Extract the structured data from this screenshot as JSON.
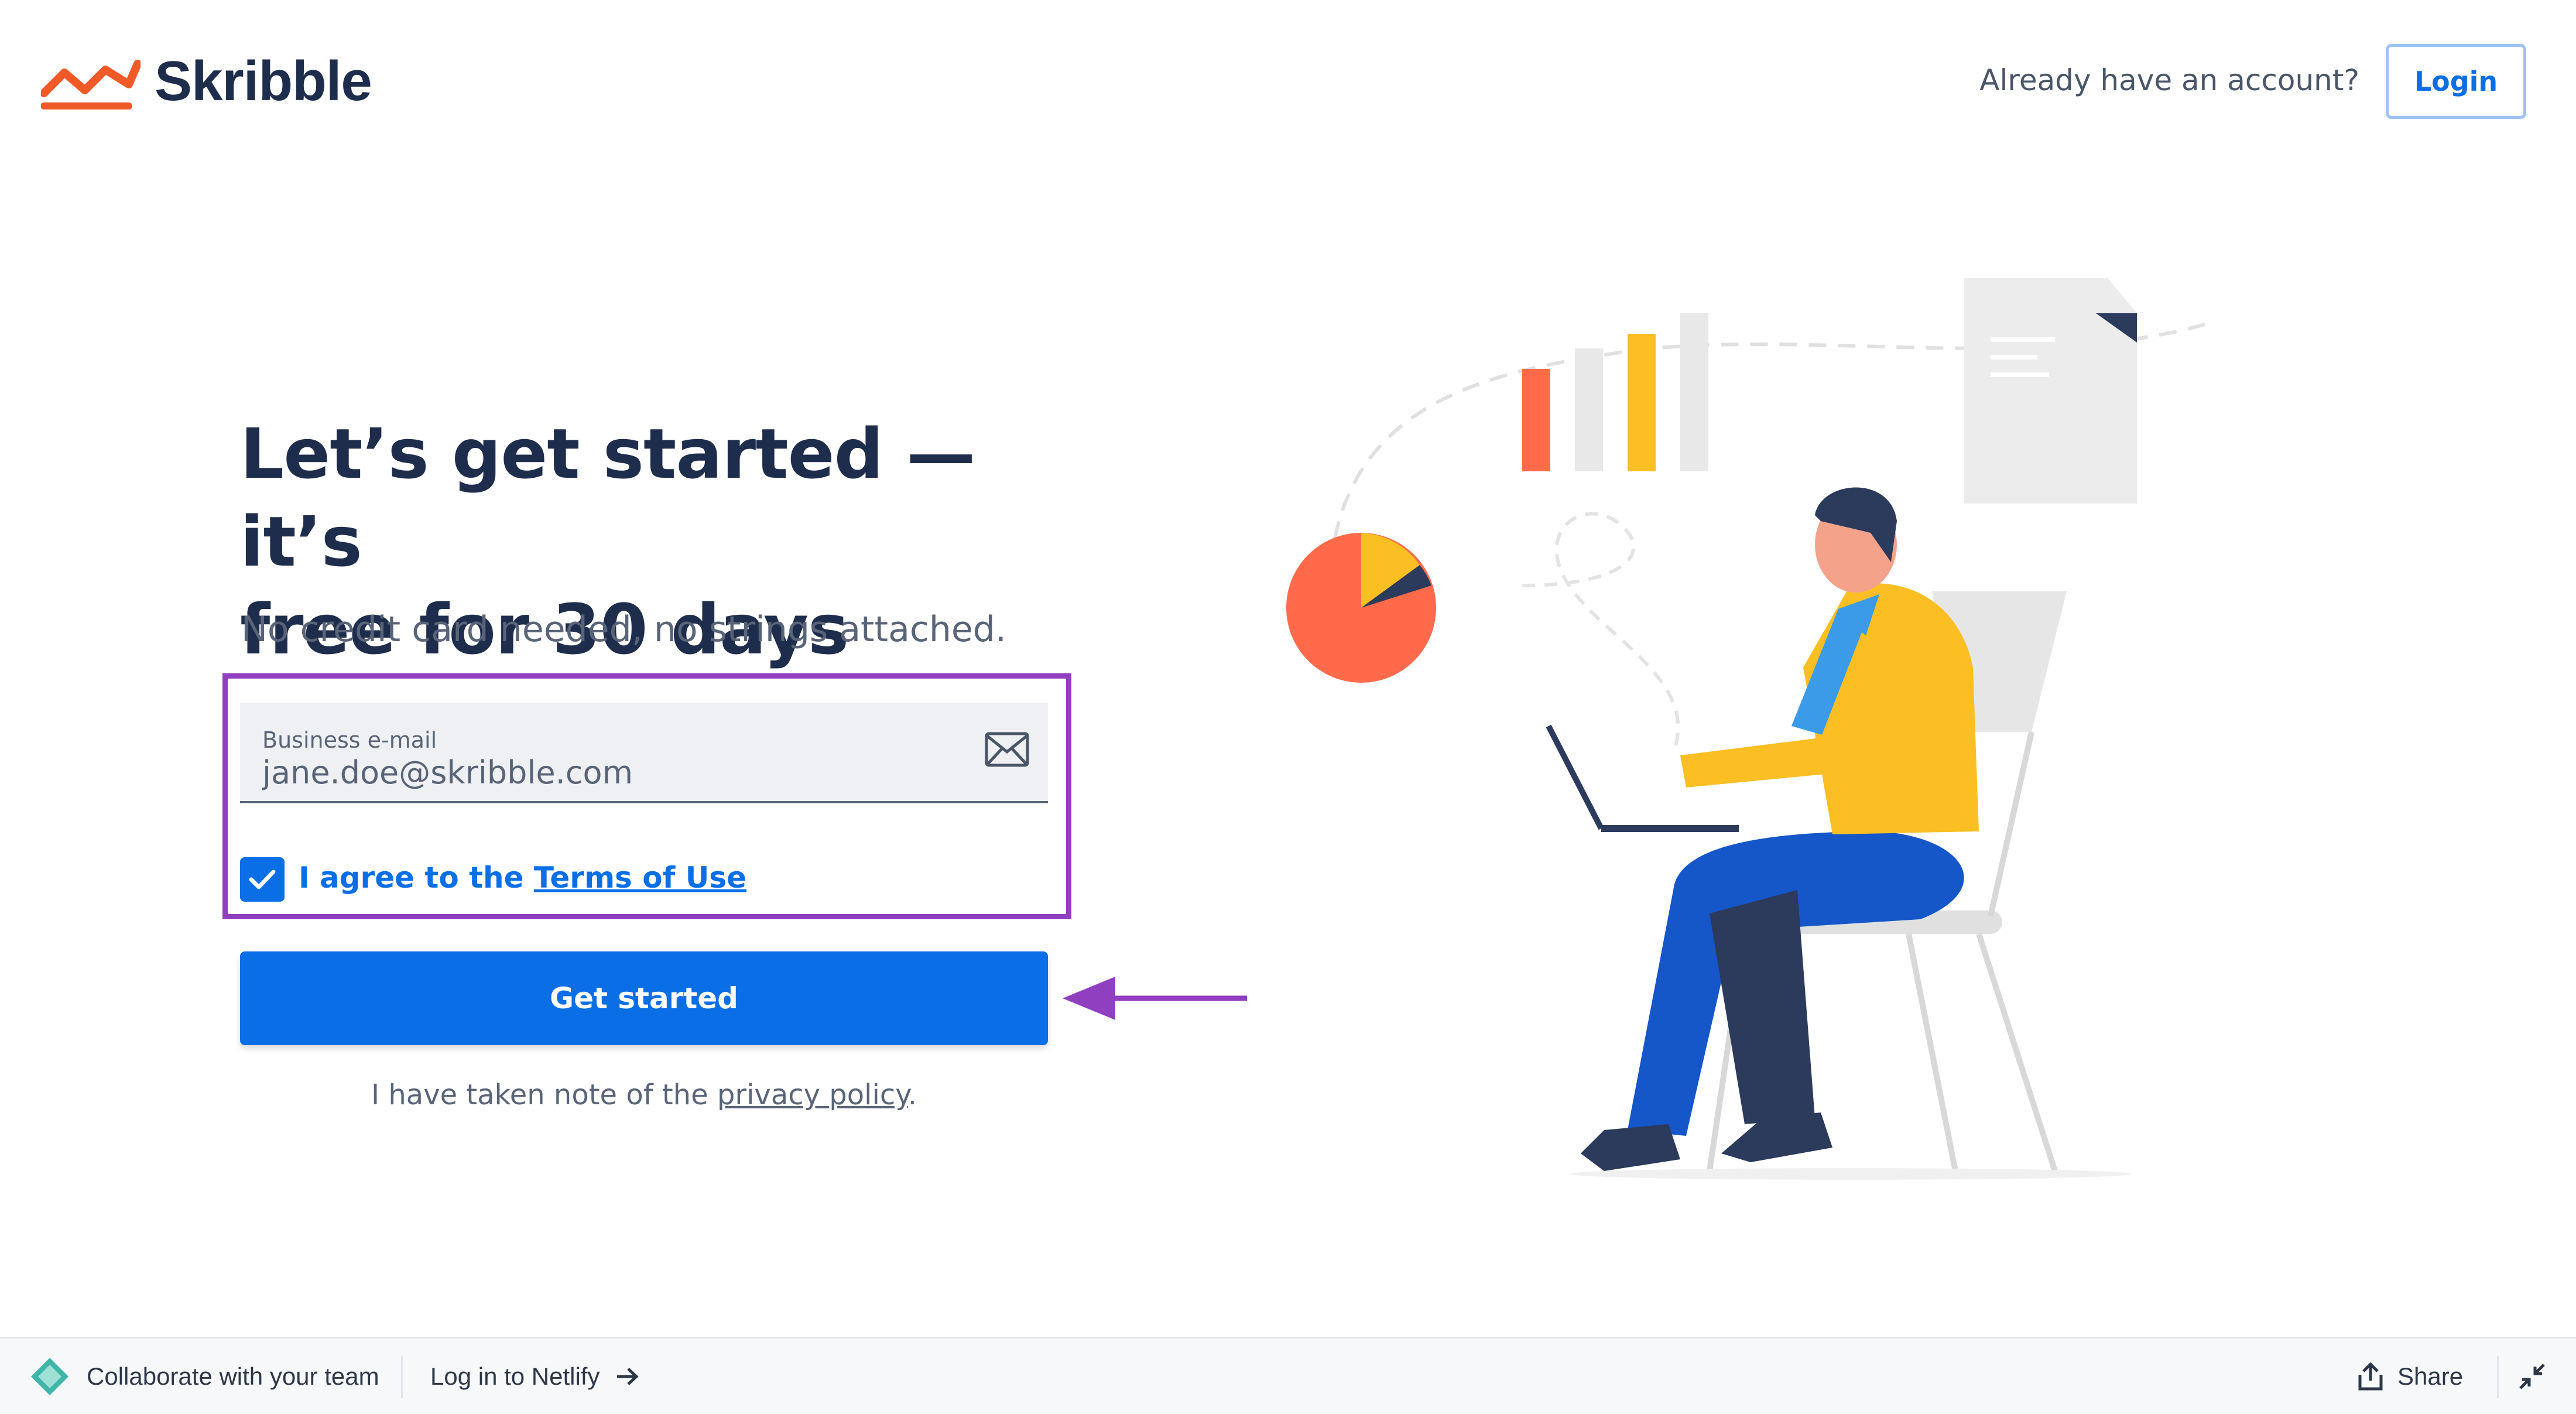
{
  "header": {
    "brand": "Skribble",
    "account_prompt": "Already have an account?",
    "login_label": "Login"
  },
  "hero": {
    "headline_line1": "Let’s get started — it’s",
    "headline_line2": "free for 30 days",
    "subtitle": "No credit card needed, no strings attached."
  },
  "form": {
    "email_label": "Business e-mail",
    "email_value": "jane.doe@skribble.com",
    "agree_prefix": "I agree to the ",
    "terms_link": "Terms of Use",
    "agree_checked": true,
    "submit_label": "Get started",
    "privacy_prefix": "I have taken note of the ",
    "privacy_link": "privacy policy",
    "privacy_suffix": "."
  },
  "bottom_bar": {
    "collaborate": "Collaborate with your team",
    "netlify_login": "Log in to Netlify",
    "share": "Share"
  },
  "colors": {
    "brand_navy": "#1f2d4d",
    "primary_blue": "#0a6fe6",
    "highlight_purple": "#8f3fbf",
    "logo_orange": "#f05a28"
  }
}
